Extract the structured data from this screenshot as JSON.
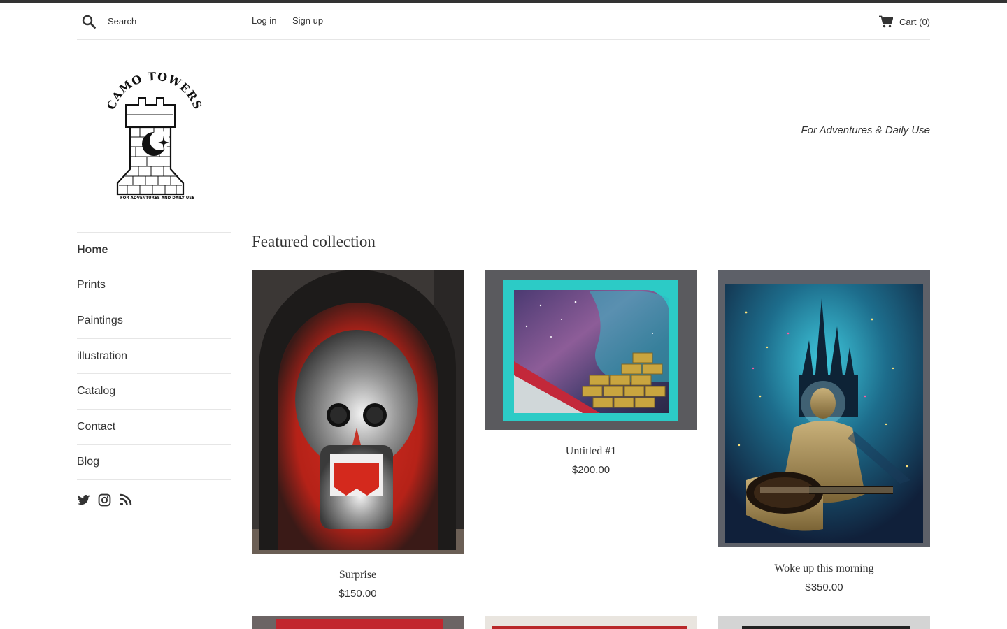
{
  "header": {
    "search_placeholder": "Search",
    "login_label": "Log in",
    "signup_label": "Sign up",
    "cart_label": "Cart (0)"
  },
  "brand": {
    "logo_arc_text": "CAMO TOWERS",
    "logo_small_text": "FOR ADVENTURES AND DAILY USE",
    "tagline": "For Adventures & Daily Use"
  },
  "nav": {
    "items": [
      {
        "label": "Home",
        "active": true
      },
      {
        "label": "Prints"
      },
      {
        "label": "Paintings"
      },
      {
        "label": "illustration"
      },
      {
        "label": "Catalog"
      },
      {
        "label": "Contact"
      },
      {
        "label": "Blog"
      }
    ]
  },
  "social": [
    "twitter-icon",
    "instagram-icon",
    "rss-icon"
  ],
  "featured": {
    "title": "Featured collection",
    "products": [
      {
        "name": "Surprise",
        "price": "$150.00"
      },
      {
        "name": "Untitled #1",
        "price": "$200.00"
      },
      {
        "name": "Woke up this morning",
        "price": "$350.00"
      }
    ]
  },
  "colors": {
    "text": "#333333",
    "topbar": "#333333",
    "divider": "#e6e6e6"
  }
}
